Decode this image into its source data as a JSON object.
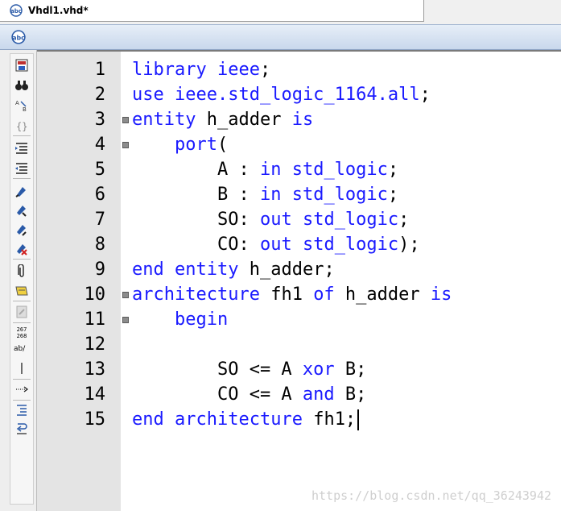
{
  "tab": {
    "title": "Vhdl1.vhd*",
    "icon": "abc-document-icon"
  },
  "window": {
    "icon": "abc-document-icon"
  },
  "toolbar": {
    "icons": [
      "save-compile-icon",
      "find-icon",
      "replace-icon",
      "braces-icon",
      "indent-icon",
      "outdent-icon",
      "bookmark-icon",
      "next-bookmark-icon",
      "prev-bookmark-icon",
      "clear-bookmarks-icon",
      "paperclip-icon",
      "insert-template-icon",
      "disabled-tool-icon",
      "line-numbers-icon",
      "word-wrap-icon",
      "vertical-line-icon",
      "show-whitespace-icon",
      "list-indent-icon",
      "wrap-return-icon"
    ],
    "line_numbers_glyph": "267\n268",
    "wrap_glyph": "ab/"
  },
  "editor": {
    "lines": [
      {
        "num": "1",
        "fold": false,
        "tokens": [
          [
            "kw",
            "library"
          ],
          [
            "p",
            " "
          ],
          [
            "kw",
            "ieee"
          ],
          [
            "p",
            ";"
          ]
        ]
      },
      {
        "num": "2",
        "fold": false,
        "tokens": [
          [
            "kw",
            "use"
          ],
          [
            "p",
            " "
          ],
          [
            "kw",
            "ieee.std_logic_1164.all"
          ],
          [
            "p",
            ";"
          ]
        ]
      },
      {
        "num": "3",
        "fold": true,
        "tokens": [
          [
            "kw",
            "entity"
          ],
          [
            "p",
            " h_adder "
          ],
          [
            "kw",
            "is"
          ]
        ]
      },
      {
        "num": "4",
        "fold": true,
        "tokens": [
          [
            "p",
            "    "
          ],
          [
            "kw",
            "port"
          ],
          [
            "p",
            "("
          ]
        ]
      },
      {
        "num": "5",
        "fold": false,
        "tokens": [
          [
            "p",
            "        A : "
          ],
          [
            "kw",
            "in"
          ],
          [
            "p",
            " "
          ],
          [
            "kw",
            "std_logic"
          ],
          [
            "p",
            ";"
          ]
        ]
      },
      {
        "num": "6",
        "fold": false,
        "tokens": [
          [
            "p",
            "        B : "
          ],
          [
            "kw",
            "in"
          ],
          [
            "p",
            " "
          ],
          [
            "kw",
            "std_logic"
          ],
          [
            "p",
            ";"
          ]
        ]
      },
      {
        "num": "7",
        "fold": false,
        "tokens": [
          [
            "p",
            "        SO: "
          ],
          [
            "kw",
            "out"
          ],
          [
            "p",
            " "
          ],
          [
            "kw",
            "std_logic"
          ],
          [
            "p",
            ";"
          ]
        ]
      },
      {
        "num": "8",
        "fold": false,
        "tokens": [
          [
            "p",
            "        CO: "
          ],
          [
            "kw",
            "out"
          ],
          [
            "p",
            " "
          ],
          [
            "kw",
            "std_logic"
          ],
          [
            "p",
            ");"
          ]
        ]
      },
      {
        "num": "9",
        "fold": false,
        "tokens": [
          [
            "kw",
            "end"
          ],
          [
            "p",
            " "
          ],
          [
            "kw",
            "entity"
          ],
          [
            "p",
            " h_adder;"
          ]
        ]
      },
      {
        "num": "10",
        "fold": true,
        "tokens": [
          [
            "kw",
            "architecture"
          ],
          [
            "p",
            " fh1 "
          ],
          [
            "kw",
            "of"
          ],
          [
            "p",
            " h_adder "
          ],
          [
            "kw",
            "is"
          ]
        ]
      },
      {
        "num": "11",
        "fold": true,
        "tokens": [
          [
            "p",
            "    "
          ],
          [
            "kw",
            "begin"
          ]
        ]
      },
      {
        "num": "12",
        "fold": false,
        "tokens": []
      },
      {
        "num": "13",
        "fold": false,
        "tokens": [
          [
            "p",
            "        SO <= A "
          ],
          [
            "kw",
            "xor"
          ],
          [
            "p",
            " B;"
          ]
        ]
      },
      {
        "num": "14",
        "fold": false,
        "tokens": [
          [
            "p",
            "        CO <= A "
          ],
          [
            "kw",
            "and"
          ],
          [
            "p",
            " B;"
          ]
        ]
      },
      {
        "num": "15",
        "fold": false,
        "tokens": [
          [
            "kw",
            "end"
          ],
          [
            "p",
            " "
          ],
          [
            "kw",
            "architecture"
          ],
          [
            "p",
            " fh1;"
          ]
        ]
      }
    ]
  },
  "watermark": "https://blog.csdn.net/qq_36243942"
}
